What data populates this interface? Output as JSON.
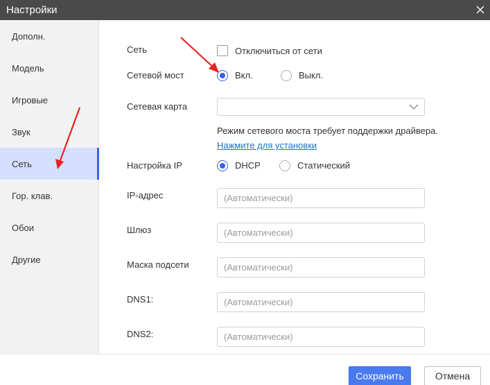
{
  "window": {
    "title": "Настройки"
  },
  "sidebar": {
    "items": [
      {
        "label": "Дополн."
      },
      {
        "label": "Модель"
      },
      {
        "label": "Игровые"
      },
      {
        "label": "Звук"
      },
      {
        "label": "Сеть",
        "active": true
      },
      {
        "label": "Гор. клав."
      },
      {
        "label": "Обои"
      },
      {
        "label": "Другие"
      }
    ]
  },
  "network": {
    "label": "Сеть",
    "disconnect_label": "Отключиться от сети",
    "disconnect_checked": false
  },
  "bridge": {
    "label": "Сетевой мост",
    "on_label": "Вкл.",
    "off_label": "Выкл.",
    "selected": "on"
  },
  "card": {
    "label": "Сетевая карта",
    "value": ""
  },
  "driver_note": {
    "text": "Режим сетевого моста требует поддержки драйвера.",
    "link": "Нажмите для установки"
  },
  "ip_setup": {
    "label": "Настройка IP",
    "dhcp_label": "DHCP",
    "static_label": "Статический",
    "selected": "dhcp"
  },
  "fields": {
    "ip": {
      "label": "IP-адрес",
      "placeholder": "(Автоматически)"
    },
    "gateway": {
      "label": "Шлюз",
      "placeholder": "(Автоматически)"
    },
    "mask": {
      "label": "Маска подсети",
      "placeholder": "(Автоматически)"
    },
    "dns1": {
      "label": "DNS1:",
      "placeholder": "(Автоматически)"
    },
    "dns2": {
      "label": "DNS2:",
      "placeholder": "(Автоматически)"
    }
  },
  "footer": {
    "save_label": "Сохранить",
    "cancel_label": "Отмена"
  },
  "colors": {
    "accent": "#3a62e8",
    "annotation_arrow": "#e8201f",
    "titlebar": "#4a4a4a"
  }
}
